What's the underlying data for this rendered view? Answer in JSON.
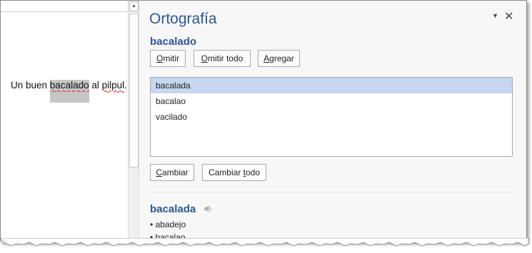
{
  "document": {
    "text_before": "Un buen ",
    "flagged_word": "bacalado",
    "text_middle": " al ",
    "flagged_word_2": "pilpul",
    "text_after": "."
  },
  "pane": {
    "title": "Ortografía",
    "menu_glyph": "▼",
    "close_glyph": "✕",
    "misspelled_word": "bacalado",
    "buttons": {
      "ignore": {
        "acc": "O",
        "rest": "mitir"
      },
      "ignore_all": {
        "acc": "O",
        "rest": "mitir todo"
      },
      "add": {
        "acc": "A",
        "rest": "gregar"
      },
      "change": {
        "acc": "C",
        "rest": "ambiar"
      },
      "change_all": {
        "pre": "Cambiar ",
        "acc": "t",
        "rest": "odo"
      }
    },
    "suggestions": [
      "bacalada",
      "bacalao",
      "vacilado"
    ],
    "selected_suggestion": "bacalada",
    "definition_word": "bacalada",
    "synonyms": [
      "• abadejo",
      "• bacalao"
    ]
  },
  "scrollbar": {
    "up_arrow": "▲"
  },
  "colors": {
    "accent": "#2b579a",
    "selection": "#c5d7f1",
    "squiggle": "#e0281e"
  },
  "icons": {
    "speaker": "speaker-icon",
    "close": "close-icon",
    "menu": "dropdown-arrow-icon"
  }
}
